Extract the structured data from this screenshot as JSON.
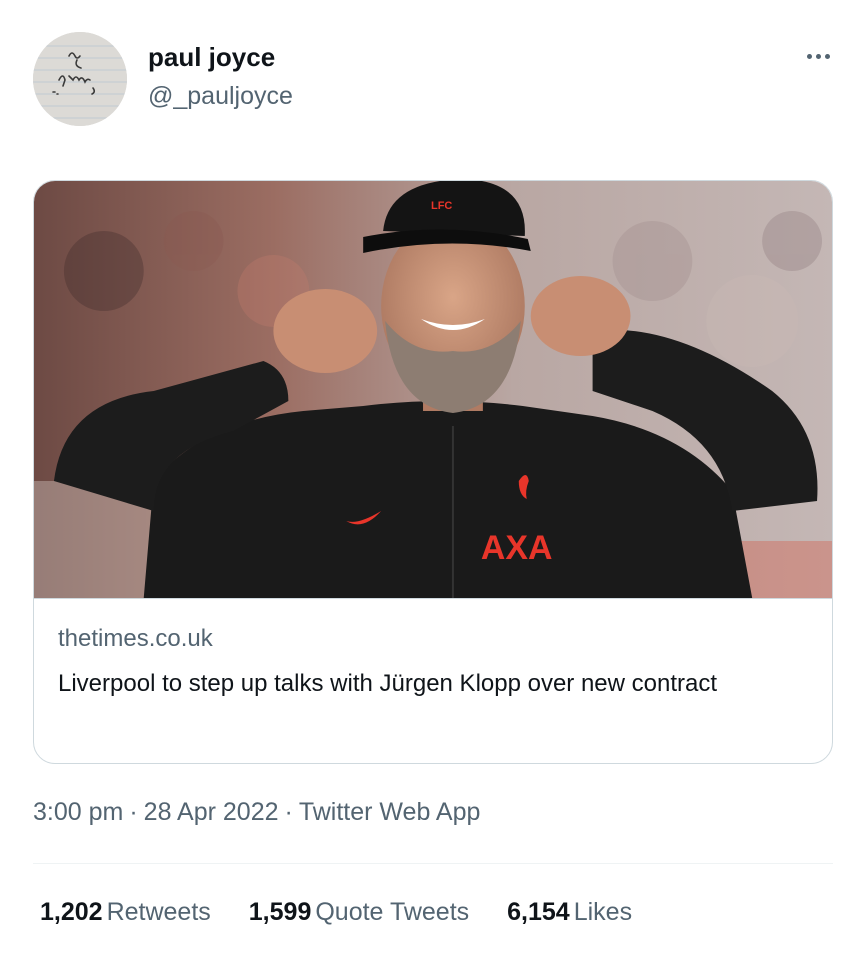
{
  "author": {
    "display_name": "paul joyce",
    "handle": "@_pauljoyce"
  },
  "card": {
    "domain": "thetimes.co.uk",
    "title": "Liverpool to step up talks with Jürgen Klopp over new contract",
    "image_brand_text": "AXA",
    "image_cap_text": "LFC"
  },
  "meta": {
    "time": "3:00 pm",
    "date": "28 Apr 2022",
    "source": "Twitter Web App",
    "separator": "·"
  },
  "stats": [
    {
      "count": "1,202",
      "label": "Retweets"
    },
    {
      "count": "1,599",
      "label": "Quote Tweets"
    },
    {
      "count": "6,154",
      "label": "Likes"
    }
  ],
  "colors": {
    "text_primary": "#0f1419",
    "text_secondary": "#536471",
    "border": "#cfd9de",
    "brand_red": "#e8352a"
  },
  "icons": {
    "more": "more-horizontal-icon"
  }
}
